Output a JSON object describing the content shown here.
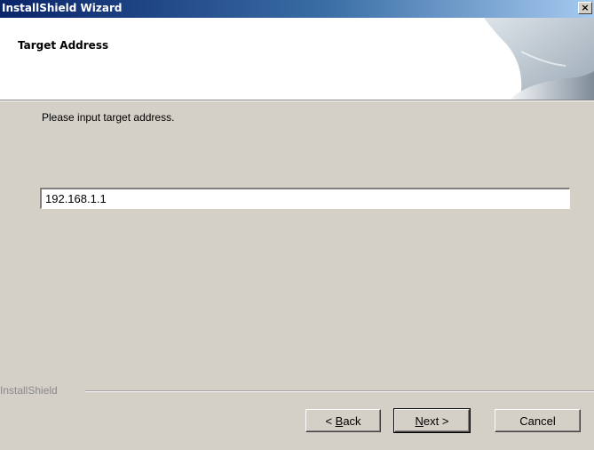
{
  "window": {
    "title": "InstallShield Wizard",
    "close_glyph": "×"
  },
  "header": {
    "title": "Target Address"
  },
  "body": {
    "prompt": "Please input target address.",
    "address_value": "192.168.1.1"
  },
  "footer": {
    "brand": "InstallShield",
    "back_prefix": "< ",
    "back_mnemonic": "B",
    "back_rest": "ack",
    "next_mnemonic": "N",
    "next_rest": "ext >",
    "cancel_label": "Cancel"
  },
  "colors": {
    "titlebar_start": "#0a246a",
    "titlebar_end": "#a6caf0",
    "dialog_face": "#d4d0c8",
    "header_background": "#ffffff"
  },
  "icons": {
    "close": "close-icon",
    "header": "page-curl-icon"
  }
}
